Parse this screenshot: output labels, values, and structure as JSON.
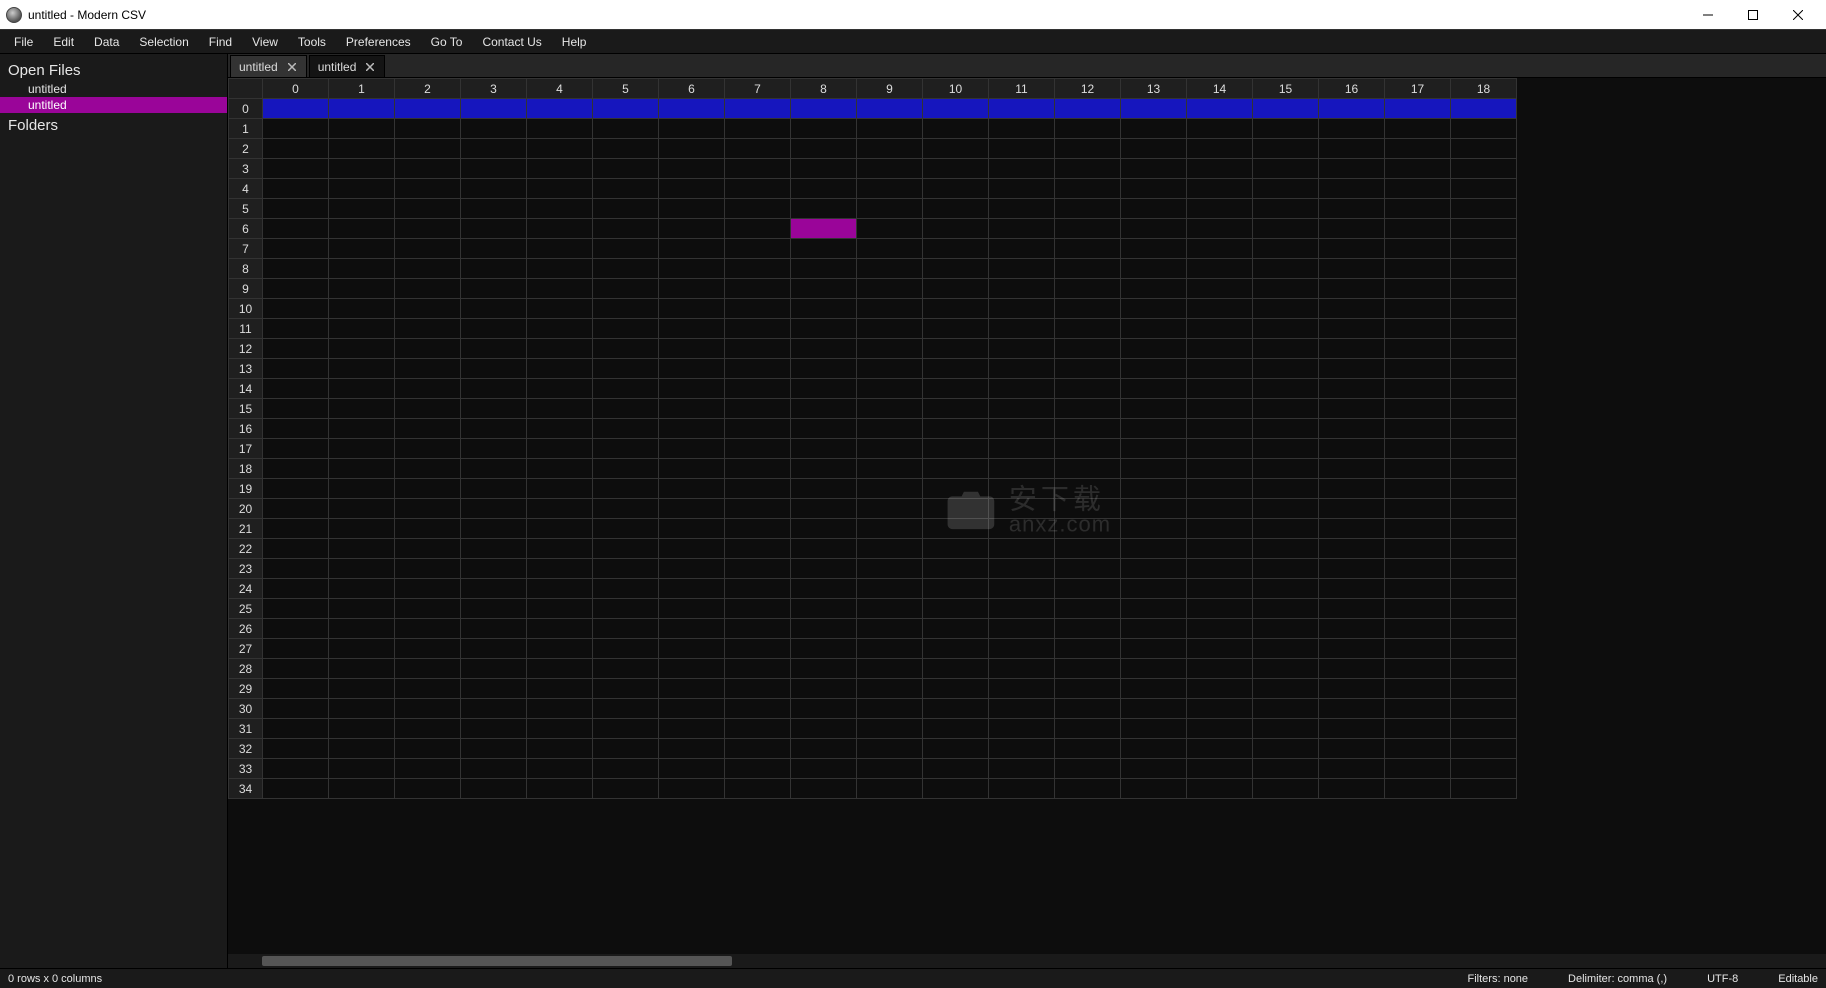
{
  "window": {
    "title": "untitled - Modern CSV"
  },
  "menu": {
    "items": [
      "File",
      "Edit",
      "Data",
      "Selection",
      "Find",
      "View",
      "Tools",
      "Preferences",
      "Go To",
      "Contact Us",
      "Help"
    ]
  },
  "sidebar": {
    "open_files_header": "Open Files",
    "folders_header": "Folders",
    "files": [
      {
        "name": "untitled",
        "selected": false
      },
      {
        "name": "untitled",
        "selected": true
      }
    ]
  },
  "tabs": {
    "items": [
      {
        "label": "untitled",
        "active": false
      },
      {
        "label": "untitled",
        "active": true
      }
    ]
  },
  "grid": {
    "col_count": 19,
    "row_count": 35,
    "highlight_row": 0,
    "selected_cell": {
      "row": 6,
      "col": 8
    }
  },
  "status": {
    "dims": "0 rows x 0 columns",
    "filters": "Filters: none",
    "delimiter": "Delimiter: comma (,)",
    "encoding": "UTF-8",
    "mode": "Editable"
  },
  "watermark": {
    "line1": "安下载",
    "line2": "anxz.com"
  }
}
